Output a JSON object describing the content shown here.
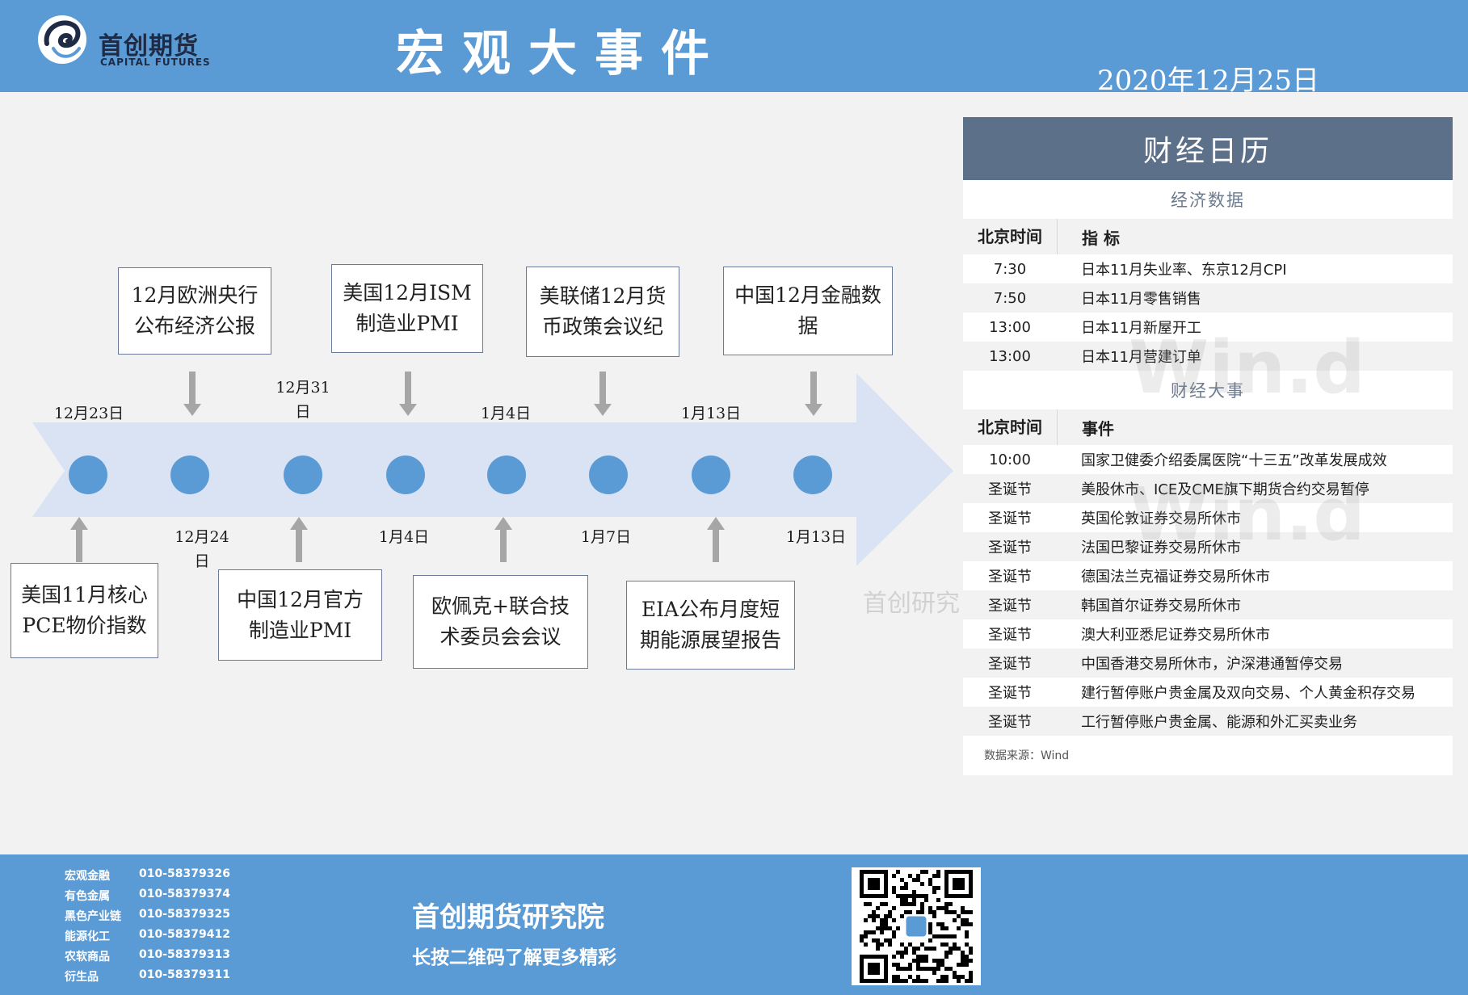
{
  "header": {
    "logo_cn": "首创期货",
    "logo_en": "CAPITAL FUTURES",
    "title": "宏观大事件",
    "date": "2020年12月25日"
  },
  "timeline": {
    "top_events": [
      {
        "lines": [
          "12月欧洲央行",
          "公布经济公报"
        ]
      },
      {
        "lines": [
          "美国12月ISM",
          "制造业PMI"
        ]
      },
      {
        "lines": [
          "美联储12月货",
          "币政策会议纪"
        ]
      },
      {
        "lines": [
          "中国12月金融数",
          "据"
        ]
      }
    ],
    "bottom_events": [
      {
        "lines": [
          "美国11月核心",
          "PCE物价指数"
        ]
      },
      {
        "lines": [
          "中国12月官方",
          "制造业PMI"
        ]
      },
      {
        "lines": [
          "欧佩克+联合技",
          "术委员会会议"
        ]
      },
      {
        "lines": [
          "EIA公布月度短",
          "期能源展望报告"
        ]
      }
    ],
    "upper_dates": [
      {
        "lines": [
          "12月23日"
        ]
      },
      {
        "lines": [
          "12月31",
          "日"
        ]
      },
      {
        "lines": [
          "1月4日"
        ]
      },
      {
        "lines": [
          "1月13日"
        ]
      }
    ],
    "lower_dates": [
      {
        "lines": [
          "12月24",
          "日"
        ]
      },
      {
        "lines": [
          "1月4日"
        ]
      },
      {
        "lines": [
          "1月7日"
        ]
      },
      {
        "lines": [
          "1月13日"
        ]
      }
    ],
    "colors": {
      "arrow": "#dae3f3",
      "node": "#5b9bd5",
      "pointer": "#a6a6a6"
    }
  },
  "calendar": {
    "title": "财经日历",
    "econ_title": "经济数据",
    "econ_header": {
      "time": "北京时间",
      "item": "指 标"
    },
    "econ_rows": [
      {
        "time": "7:30",
        "item": "日本11月失业率、东京12月CPI"
      },
      {
        "time": "7:50",
        "item": "日本11月零售销售"
      },
      {
        "time": "13:00",
        "item": "日本11月新屋开工"
      },
      {
        "time": "13:00",
        "item": "日本11月营建订单"
      }
    ],
    "events_title": "财经大事",
    "events_header": {
      "time": "北京时间",
      "item": "事件"
    },
    "event_rows": [
      {
        "time": "10:00",
        "item": "国家卫健委介绍委属医院“十三五”改革发展成效"
      },
      {
        "time": "圣诞节",
        "item": "美股休市、ICE及CME旗下期货合约交易暂停"
      },
      {
        "time": "圣诞节",
        "item": "英国伦敦证券交易所休市"
      },
      {
        "time": "圣诞节",
        "item": "法国巴黎证券交易所休市"
      },
      {
        "time": "圣诞节",
        "item": "德国法兰克福证券交易所休市"
      },
      {
        "time": "圣诞节",
        "item": "韩国首尔证券交易所休市"
      },
      {
        "time": "圣诞节",
        "item": "澳大利亚悉尼证券交易所休市"
      },
      {
        "time": "圣诞节",
        "item": "中国香港交易所休市，沪深港通暂停交易"
      },
      {
        "time": "圣诞节",
        "item": "建行暂停账户贵金属及双向交易、个人黄金积存交易"
      },
      {
        "time": "圣诞节",
        "item": "工行暂停账户贵金属、能源和外汇买卖业务"
      }
    ],
    "source": "数据来源：Wind",
    "watermark": "Win.d",
    "watermark2": "首创研究"
  },
  "footer": {
    "contacts": [
      {
        "name": "宏观金融",
        "phone": "010-58379326"
      },
      {
        "name": "有色金属",
        "phone": "010-58379374"
      },
      {
        "name": "黑色产业链",
        "phone": "010-58379325"
      },
      {
        "name": "能源化工",
        "phone": "010-58379412"
      },
      {
        "name": "农软商品",
        "phone": "010-58379313"
      },
      {
        "name": "衍生品",
        "phone": "010-58379311"
      }
    ],
    "institute": "首创期货研究院",
    "tagline": "长按二维码了解更多精彩",
    "qr_icon": "qr-code-icon"
  }
}
